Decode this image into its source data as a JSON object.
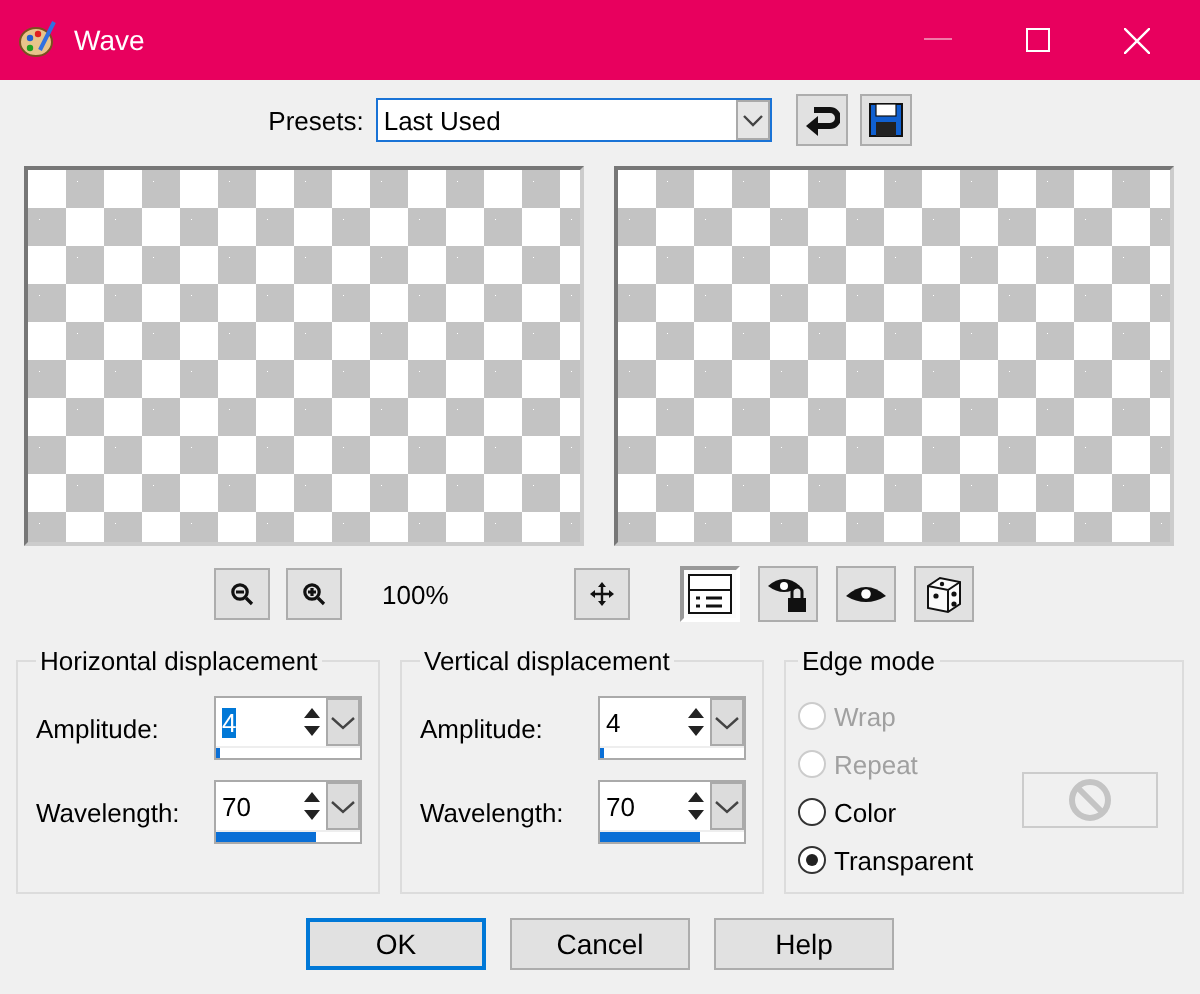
{
  "window": {
    "title": "Wave"
  },
  "presets": {
    "label": "Presets:",
    "value": "Last Used"
  },
  "toolbar": {
    "zoom": "100%",
    "tools": [
      {
        "kind": "proof",
        "pressed": true
      },
      {
        "kind": "lock-eye",
        "pressed": false
      },
      {
        "kind": "eye",
        "pressed": false
      },
      {
        "kind": "dice",
        "pressed": false
      }
    ]
  },
  "groups": [
    {
      "title": "Horizontal displacement",
      "fields": [
        {
          "label": "Amplitude:",
          "value": "4",
          "selected": true,
          "level": 0.03
        },
        {
          "label": "Wavelength:",
          "value": "70",
          "selected": false,
          "level": 0.7
        }
      ]
    },
    {
      "title": "Vertical displacement",
      "fields": [
        {
          "label": "Amplitude:",
          "value": "4",
          "selected": false,
          "level": 0.03
        },
        {
          "label": "Wavelength:",
          "value": "70",
          "selected": false,
          "level": 0.7
        }
      ]
    }
  ],
  "edge_mode": {
    "title": "Edge mode",
    "options": [
      {
        "label": "Wrap",
        "selected": false,
        "disabled": true
      },
      {
        "label": "Repeat",
        "selected": false,
        "disabled": true
      },
      {
        "label": "Color",
        "selected": false,
        "disabled": false
      },
      {
        "label": "Transparent",
        "selected": true,
        "disabled": false
      }
    ],
    "color_disabled": true
  },
  "buttons": [
    {
      "label": "OK",
      "default": true
    },
    {
      "label": "Cancel",
      "default": false
    },
    {
      "label": "Help",
      "default": false
    }
  ]
}
